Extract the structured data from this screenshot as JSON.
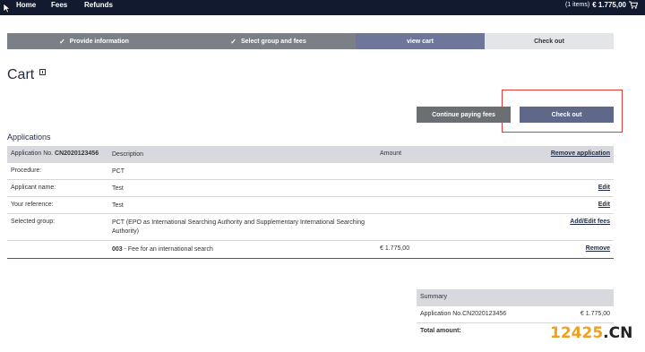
{
  "topnav": {
    "home": "Home",
    "fees": "Fees",
    "refunds": "Refunds",
    "cart_items": "(1 items)",
    "cart_total": "€ 1.775,00"
  },
  "steps": [
    {
      "label": "Provide information"
    },
    {
      "label": "Select group and fees"
    },
    {
      "label": "view cart"
    },
    {
      "label": "Check out"
    }
  ],
  "page_title": "Cart",
  "buttons": {
    "continue": "Continue paying fees",
    "checkout": "Check out"
  },
  "section_label": "Applications",
  "table": {
    "header": {
      "application_label": "Application No.",
      "application_no": "CN2020123456",
      "description": "Description",
      "amount": "Amount",
      "action": "Remove application"
    },
    "rows": [
      {
        "label": "Procedure:",
        "value": "PCT",
        "amount": "",
        "action": ""
      },
      {
        "label": "Applicant name:",
        "value": "Test",
        "amount": "",
        "action": "Edit"
      },
      {
        "label": "Your reference:",
        "value": "Test",
        "amount": "",
        "action": "Edit"
      },
      {
        "label": "Selected group:",
        "value": "PCT (EPO as International Searching Authority and Supplementary International Searching Authority)",
        "amount": "",
        "action": "Add/Edit fees"
      }
    ],
    "fee_row": {
      "code": "003",
      "description": " - Fee for an international search",
      "amount": "€ 1.775,00",
      "action": "Remove"
    }
  },
  "summary": {
    "title": "Summary",
    "line_label": "Application No.CN2020123456",
    "line_amount": "€ 1.775,00",
    "total_label": "Total amount:"
  },
  "watermark": {
    "part1": "12425",
    "part2": ".CN"
  }
}
